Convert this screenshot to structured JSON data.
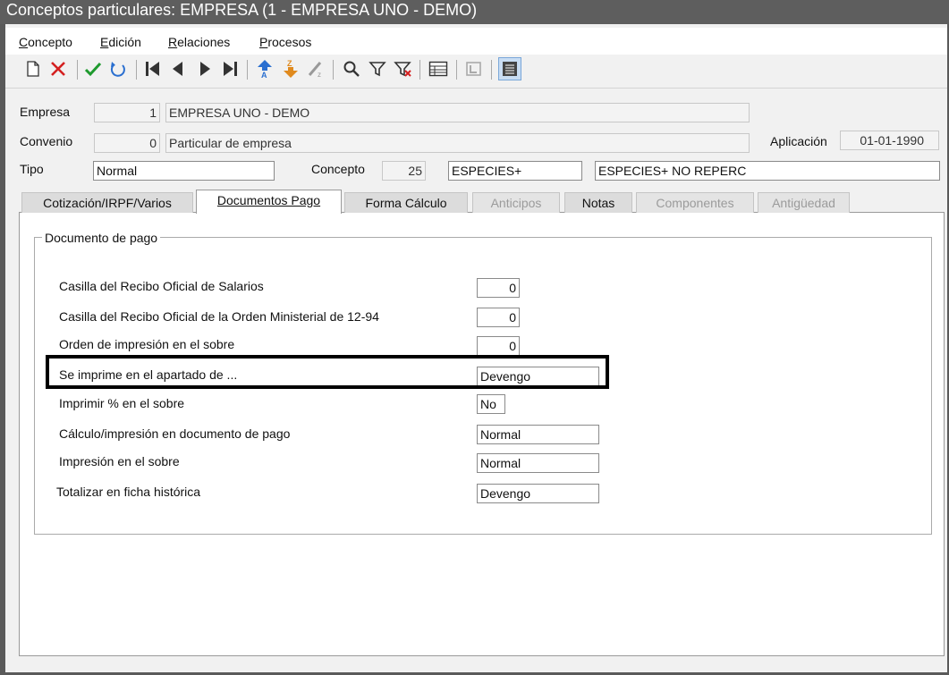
{
  "window": {
    "title": "Conceptos particulares: EMPRESA (1 - EMPRESA UNO - DEMO)"
  },
  "menu": [
    {
      "label": "Concepto",
      "u": "C",
      "rest": "oncepto"
    },
    {
      "label": "Edición",
      "u": "E",
      "rest": "dición"
    },
    {
      "label": "Relaciones",
      "u": "R",
      "rest": "elaciones"
    },
    {
      "label": "Procesos",
      "u": "P",
      "rest": "rocesos"
    }
  ],
  "toolbar": {
    "icons": [
      "new-icon",
      "delete-icon",
      "accept-icon",
      "undo-icon",
      "first-icon",
      "previous-icon",
      "next-icon",
      "last-icon",
      "sort-asc-icon",
      "sort-desc-icon",
      "sort-clear-icon",
      "search-icon",
      "filter-icon",
      "filter-clear-icon",
      "grid-icon",
      "detail-icon",
      "form-icon"
    ]
  },
  "header": {
    "empresa_label": "Empresa",
    "empresa_code": "1",
    "empresa_name": "EMPRESA UNO - DEMO",
    "convenio_label": "Convenio",
    "convenio_code": "0",
    "convenio_name": "Particular de empresa",
    "aplicacion_label": "Aplicación",
    "aplicacion_value": "01-01-1990",
    "tipo_label": "Tipo",
    "tipo_value": "Normal",
    "concepto_label": "Concepto",
    "concepto_code": "25",
    "concepto_short": "ESPECIES+",
    "concepto_long": "ESPECIES+ NO REPERC"
  },
  "tabs": [
    {
      "label": "Cotización/IRPF/Varios",
      "state": "normal"
    },
    {
      "label": "Documentos Pago",
      "state": "active"
    },
    {
      "label": "Forma Cálculo",
      "state": "normal"
    },
    {
      "label": "Anticipos",
      "state": "disabled"
    },
    {
      "label": "Notas",
      "state": "normal"
    },
    {
      "label": "Componentes",
      "state": "disabled"
    },
    {
      "label": "Antigüedad",
      "state": "disabled"
    }
  ],
  "documento_pago": {
    "group_title": "Documento de pago",
    "rows": [
      {
        "label": "Casilla del Recibo Oficial de Salarios",
        "value": "0"
      },
      {
        "label": "Casilla del Recibo Oficial de la Orden Ministerial de 12-94",
        "value": "0"
      },
      {
        "label": "Orden de impresión en el sobre",
        "value": "0"
      },
      {
        "label": "Se imprime en el apartado de ...",
        "value": "Devengo"
      },
      {
        "label": "Imprimir % en el sobre",
        "value": "No"
      },
      {
        "label": "Cálculo/impresión en documento de pago",
        "value": "Normal"
      },
      {
        "label": "Impresión en el sobre",
        "value": "Normal"
      },
      {
        "label": "Totalizar en ficha histórica",
        "value": "Devengo"
      }
    ]
  }
}
